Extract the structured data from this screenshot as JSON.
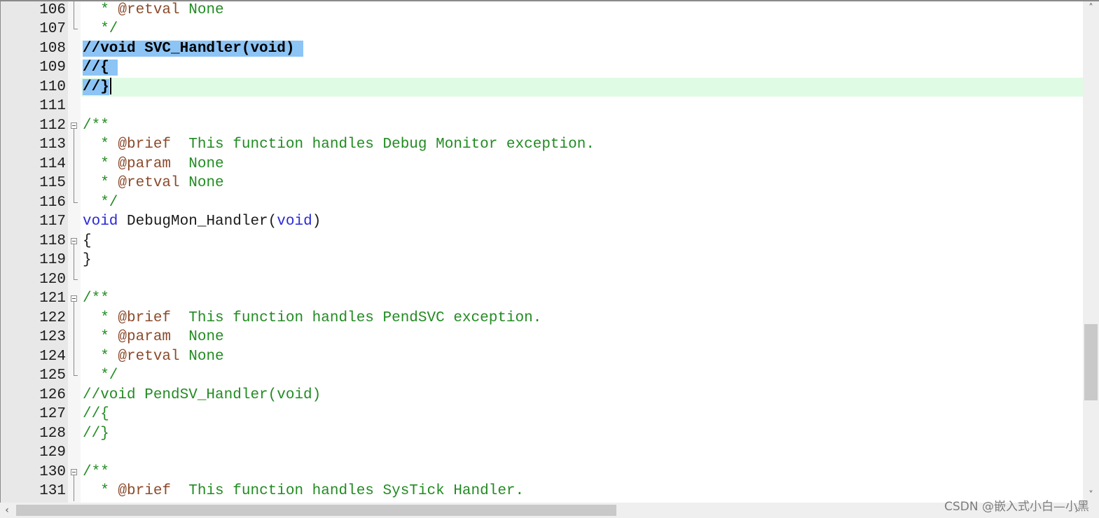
{
  "editor": {
    "current_line": 110,
    "lines": [
      {
        "num": "106",
        "fold": "line",
        "tokens": [
          {
            "t": "  * ",
            "c": "comment"
          },
          {
            "t": "@retval",
            "c": "tag"
          },
          {
            "t": " None",
            "c": "comment"
          }
        ]
      },
      {
        "num": "107",
        "fold": "end",
        "tokens": [
          {
            "t": "  */",
            "c": "comment"
          }
        ]
      },
      {
        "num": "108",
        "fold": "none",
        "selected": true,
        "tokens": [
          {
            "t": "//void SVC_Handler(void) ",
            "c": "comment-sel"
          }
        ]
      },
      {
        "num": "109",
        "fold": "none",
        "selected": true,
        "tokens": [
          {
            "t": "//{ ",
            "c": "comment-sel"
          }
        ]
      },
      {
        "num": "110",
        "fold": "none",
        "selected": true,
        "caret": true,
        "tokens": [
          {
            "t": "//}",
            "c": "comment-sel"
          }
        ]
      },
      {
        "num": "111",
        "fold": "none",
        "tokens": []
      },
      {
        "num": "112",
        "fold": "start",
        "tokens": [
          {
            "t": "/**",
            "c": "comment"
          }
        ]
      },
      {
        "num": "113",
        "fold": "line",
        "tokens": [
          {
            "t": "  * ",
            "c": "comment"
          },
          {
            "t": "@brief",
            "c": "tag"
          },
          {
            "t": "  This function handles Debug Monitor exception.",
            "c": "comment"
          }
        ]
      },
      {
        "num": "114",
        "fold": "line",
        "tokens": [
          {
            "t": "  * ",
            "c": "comment"
          },
          {
            "t": "@param",
            "c": "tag"
          },
          {
            "t": "  None",
            "c": "comment"
          }
        ]
      },
      {
        "num": "115",
        "fold": "line",
        "tokens": [
          {
            "t": "  * ",
            "c": "comment"
          },
          {
            "t": "@retval",
            "c": "tag"
          },
          {
            "t": " None",
            "c": "comment"
          }
        ]
      },
      {
        "num": "116",
        "fold": "end",
        "tokens": [
          {
            "t": "  */",
            "c": "comment"
          }
        ]
      },
      {
        "num": "117",
        "fold": "none",
        "tokens": [
          {
            "t": "void",
            "c": "kw"
          },
          {
            "t": " DebugMon_Handler(",
            "c": "plain"
          },
          {
            "t": "void",
            "c": "kw"
          },
          {
            "t": ")",
            "c": "plain"
          }
        ]
      },
      {
        "num": "118",
        "fold": "start",
        "tokens": [
          {
            "t": "{",
            "c": "plain"
          }
        ]
      },
      {
        "num": "119",
        "fold": "line",
        "tokens": [
          {
            "t": "}",
            "c": "plain"
          }
        ]
      },
      {
        "num": "120",
        "fold": "end",
        "tokens": []
      },
      {
        "num": "121",
        "fold": "start",
        "tokens": [
          {
            "t": "/**",
            "c": "comment"
          }
        ]
      },
      {
        "num": "122",
        "fold": "line",
        "tokens": [
          {
            "t": "  * ",
            "c": "comment"
          },
          {
            "t": "@brief",
            "c": "tag"
          },
          {
            "t": "  This function handles PendSVC exception.",
            "c": "comment"
          }
        ]
      },
      {
        "num": "123",
        "fold": "line",
        "tokens": [
          {
            "t": "  * ",
            "c": "comment"
          },
          {
            "t": "@param",
            "c": "tag"
          },
          {
            "t": "  None",
            "c": "comment"
          }
        ]
      },
      {
        "num": "124",
        "fold": "line",
        "tokens": [
          {
            "t": "  * ",
            "c": "comment"
          },
          {
            "t": "@retval",
            "c": "tag"
          },
          {
            "t": " None",
            "c": "comment"
          }
        ]
      },
      {
        "num": "125",
        "fold": "end",
        "tokens": [
          {
            "t": "  */",
            "c": "comment"
          }
        ]
      },
      {
        "num": "126",
        "fold": "none",
        "tokens": [
          {
            "t": "//void PendSV_Handler(void)",
            "c": "comment"
          }
        ]
      },
      {
        "num": "127",
        "fold": "none",
        "tokens": [
          {
            "t": "//{",
            "c": "comment"
          }
        ]
      },
      {
        "num": "128",
        "fold": "none",
        "tokens": [
          {
            "t": "//}",
            "c": "comment"
          }
        ]
      },
      {
        "num": "129",
        "fold": "none",
        "tokens": []
      },
      {
        "num": "130",
        "fold": "start",
        "tokens": [
          {
            "t": "/**",
            "c": "comment"
          }
        ]
      },
      {
        "num": "131",
        "fold": "line",
        "tokens": [
          {
            "t": "  * ",
            "c": "comment"
          },
          {
            "t": "@brief",
            "c": "tag"
          },
          {
            "t": "  This function handles SysTick Handler.",
            "c": "comment"
          }
        ]
      }
    ]
  },
  "scrollbars": {
    "vertical": {
      "up_icon": "˄",
      "down_icon": "˅"
    },
    "horizontal": {
      "left_icon": "‹",
      "right_icon": "›"
    }
  },
  "watermark": "CSDN @嵌入式小白—小黑"
}
